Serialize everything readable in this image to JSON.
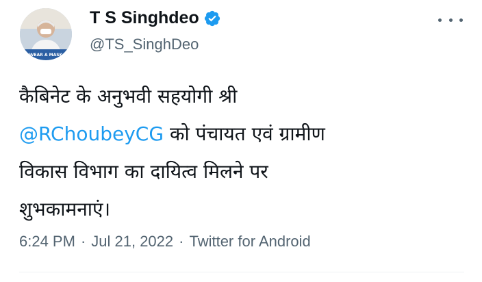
{
  "tweet": {
    "author": {
      "display_name": "T S Singhdeo",
      "handle": "@TS_SinghDeo",
      "avatar_caption": "WEAR A MASK",
      "verified": true
    },
    "text": {
      "line1": "कैबिनेट के अनुभवी सहयोगी श्री",
      "mention": "@RChoubeyCG",
      "line2_rest": " को पंचायत एवं ग्रामीण",
      "line3": "विकास विभाग का दायित्व मिलने पर",
      "line4": "शुभकामनाएं।"
    },
    "meta": {
      "time": "6:24 PM",
      "separator": "·",
      "date": "Jul 21, 2022",
      "source": "Twitter for Android"
    }
  },
  "colors": {
    "accent": "#1d9bf0",
    "text": "#0f1419",
    "secondary": "#536471"
  },
  "icons": {
    "verified": "verified-badge-icon",
    "more": "more-options-icon"
  }
}
